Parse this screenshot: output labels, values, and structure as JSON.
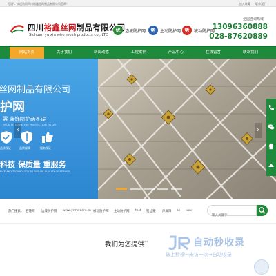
{
  "topbar": {
    "welcome": "您好，欢迎访问四川裕鑫丝网制品有限公司官网！",
    "links": [
      "加入收藏",
      "联系我们"
    ]
  },
  "header": {
    "company_cn_prefix": "四川",
    "company_cn_highlight": "裕鑫丝网",
    "company_cn_suffix": "制品有限公司",
    "company_en": "Sichuan yu xin wire mesh products co., LTD",
    "products": [
      {
        "badge": "优",
        "label": "边坡防护网",
        "color": "#2e8b3a"
      },
      {
        "badge": "势",
        "label": "主动防护网",
        "color": "#2b63b8"
      },
      {
        "badge": "势",
        "label": "被动防护网",
        "color": "#d62a22"
      }
    ],
    "hotline_label": "全国咨询热线",
    "phone1": "13096360888",
    "phone2": "028-87620889"
  },
  "nav": {
    "items": [
      "网站首页",
      "关于我们",
      "新闻动态",
      "工程案例",
      "产品中心",
      "在线留言",
      "联系我们"
    ],
    "active_index": 0,
    "color": "#1e8a3b",
    "active_color": "#f4a82a"
  },
  "banner": {
    "line1": "丝网制品有限公司",
    "line2": "护网",
    "line3": "震  装饰防护两不误",
    "line4": "ENCE TO MARK THE PROTECTION TO GO",
    "icon_labels": [
      "品质保证",
      "品质保障",
      "服务保证"
    ],
    "slogan": "科技 保质量 重服务",
    "slogan_en": "RICE AND TECHNOLOGY TO ENSURE QUALITY OF SERVICE",
    "arrow_left": "‹",
    "arrow_right": "›",
    "slide_count": 5,
    "active_slide": 0
  },
  "float_bar": {
    "icons": [
      "phone-icon",
      "wechat-icon",
      "qq-icon",
      "top-icon"
    ]
  },
  "search": {
    "label": "热门搜索：",
    "keywords": [
      "石笼网",
      "边坡防护网",
      "www.yrmwears.cn",
      "被动防护网",
      "主动防护网",
      "test",
      "铅丝笼",
      "声屏障",
      "as",
      "xxx"
    ],
    "placeholder": "输入关键字"
  },
  "section": {
    "title": "我们为您提供",
    "stars": "*****",
    "watermark": "自动秒收录",
    "watermark_sub": "做上秒榜→来访一次→自动收录"
  }
}
